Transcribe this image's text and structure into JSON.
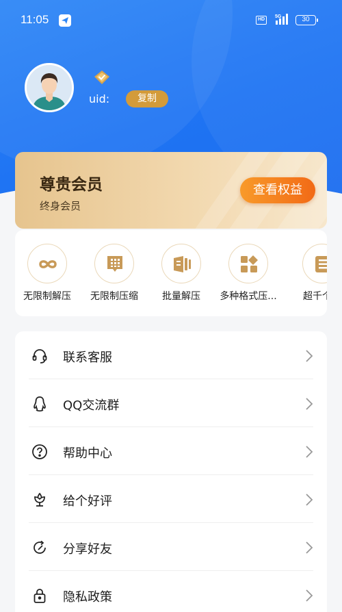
{
  "status_bar": {
    "time": "11:05",
    "hd": "HD",
    "network": "5G",
    "battery": "30"
  },
  "profile": {
    "uid_label": "uid:",
    "copy_label": "复制"
  },
  "vip": {
    "title": "尊贵会员",
    "subtitle": "终身会员",
    "button_label": "查看权益"
  },
  "features": [
    {
      "label": "无限制解压",
      "icon": "infinity-icon"
    },
    {
      "label": "无限制压缩",
      "icon": "grid-chat-icon"
    },
    {
      "label": "批量解压",
      "icon": "batch-docs-icon"
    },
    {
      "label": "多种格式压...",
      "icon": "formats-icon"
    },
    {
      "label": "超千个文",
      "icon": "file-list-icon"
    }
  ],
  "menu": [
    {
      "label": "联系客服",
      "icon": "headset-icon"
    },
    {
      "label": "QQ交流群",
      "icon": "qq-penguin-icon"
    },
    {
      "label": "帮助中心",
      "icon": "help-circle-icon"
    },
    {
      "label": "给个好评",
      "icon": "flower-icon"
    },
    {
      "label": "分享好友",
      "icon": "share-refresh-icon"
    },
    {
      "label": "隐私政策",
      "icon": "lock-icon"
    }
  ],
  "colors": {
    "primary_blue": "#1f74f3",
    "gold": "#d39b3a",
    "orange": "#f26a16"
  }
}
